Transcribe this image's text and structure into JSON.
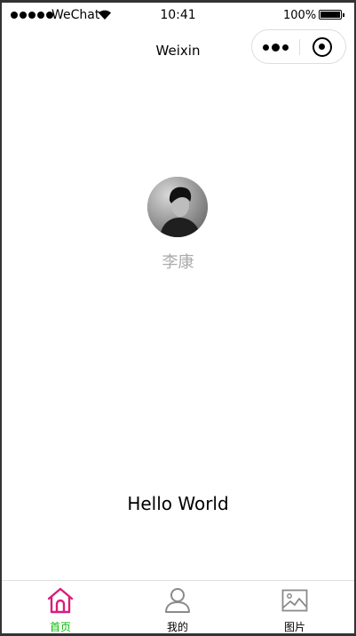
{
  "status_bar": {
    "carrier": "WeChat",
    "time": "10:41",
    "battery": "100%"
  },
  "nav": {
    "title": "Weixin"
  },
  "profile": {
    "nickname": "李康"
  },
  "content": {
    "greeting": "Hello World"
  },
  "tabbar": {
    "active_color": "#09bb07",
    "tabs": [
      {
        "label": "首页",
        "icon": "home-icon",
        "active": true
      },
      {
        "label": "我的",
        "icon": "user-icon",
        "active": false
      },
      {
        "label": "图片",
        "icon": "image-icon",
        "active": false
      }
    ]
  }
}
